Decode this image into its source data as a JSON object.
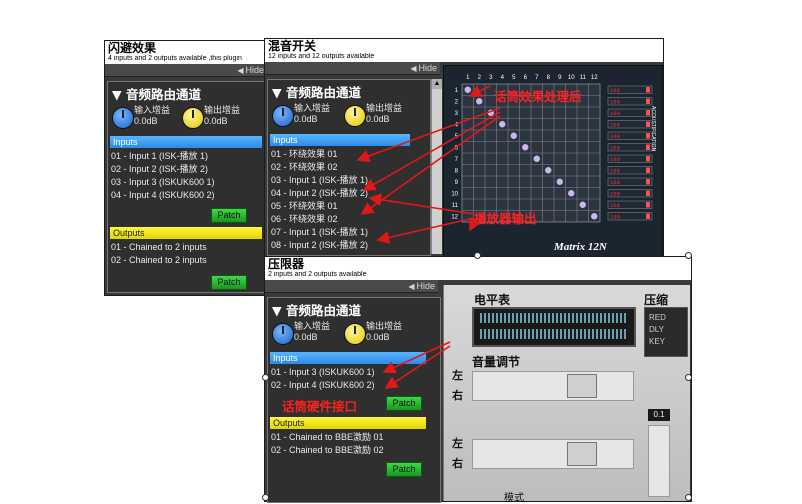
{
  "flash_panel": {
    "title": "闪避效果",
    "subtitle": "4 inputs and 2 outputs available ,this plugin",
    "hide": "Hide",
    "route_title": "音频路由通道",
    "input_gain": "输入增益",
    "input_gain_val": "0.0dB",
    "output_gain": "输出增益",
    "output_gain_val": "0.0dB",
    "inputs_label": "Inputs",
    "inputs": [
      "01 - Input 1 (ISK-播放 1)",
      "02 - Input 2 (ISK-播放 2)",
      "03 - Input 3 (ISKUK600 1)",
      "04 - Input 4 (ISKUK600 2)"
    ],
    "patch": "Patch",
    "outputs_label": "Outputs",
    "outputs": [
      "01 - Chained to 2 inputs",
      "02 - Chained to 2 inputs"
    ],
    "patch2": "Patch"
  },
  "mixer_panel": {
    "title": "混音开关",
    "subtitle": "12 inputs and 12 outputs available",
    "hide": "Hide",
    "route_title": "音频路由通道",
    "input_gain": "输入增益",
    "input_gain_val": "0.0dB",
    "output_gain": "输出增益",
    "output_gain_val": "0.0dB",
    "inputs_label": "Inputs",
    "inputs": [
      "01 - 环绕效果 01",
      "02 - 环绕效果 02",
      "03 - Input 1 (ISK-播放 1)",
      "04 - Input 2 (ISK-播放 2)",
      "05 - 环绕效果 01",
      "06 - 环绕效果 02",
      "07 - Input 1 (ISK-播放 1)",
      "08 - Input 2 (ISK-播放 2)"
    ],
    "matrix_cols": [
      "1",
      "2",
      "3",
      "4",
      "5",
      "6",
      "7",
      "8",
      "9",
      "10",
      "11",
      "12"
    ],
    "matrix_rows": [
      "1",
      "2",
      "3",
      "4",
      "5",
      "6",
      "7",
      "8",
      "9",
      "10",
      "11",
      "12"
    ],
    "matrix_value": "100",
    "matrix_brand": "Matrix 12N",
    "matrix_side": "ACOUSTIFICATION"
  },
  "limiter_panel": {
    "title": "压限器",
    "subtitle": "2 inputs and 2 outputs available",
    "hide": "Hide",
    "route_title": "音频路由通道",
    "input_gain": "输入增益",
    "input_gain_val": "0.0dB",
    "output_gain": "输出增益",
    "output_gain_val": "0.0dB",
    "inputs_label": "Inputs",
    "inputs": [
      "01 - Input 3 (ISKUK600 1)",
      "02 - Input 4 (ISKUK600 2)"
    ],
    "patch": "Patch",
    "outputs_label": "Outputs",
    "outputs": [
      "01 - Chained to BBE激励 01",
      "02 - Chained to BBE激励 02"
    ],
    "patch2": "Patch",
    "level_meter": "电平表",
    "volume": "音量调节",
    "left": "左",
    "right": "右",
    "compress": "压缩",
    "compress_mode": "模式",
    "side_btn": "RED",
    "side_btn2": "DLY",
    "side_btn3": "KEY",
    "value_box": "0.1"
  },
  "annotations": {
    "mic_effect": "话筒效果处理后",
    "player_out": "播放器输出",
    "mic_hw": "话筒硬件接口"
  }
}
